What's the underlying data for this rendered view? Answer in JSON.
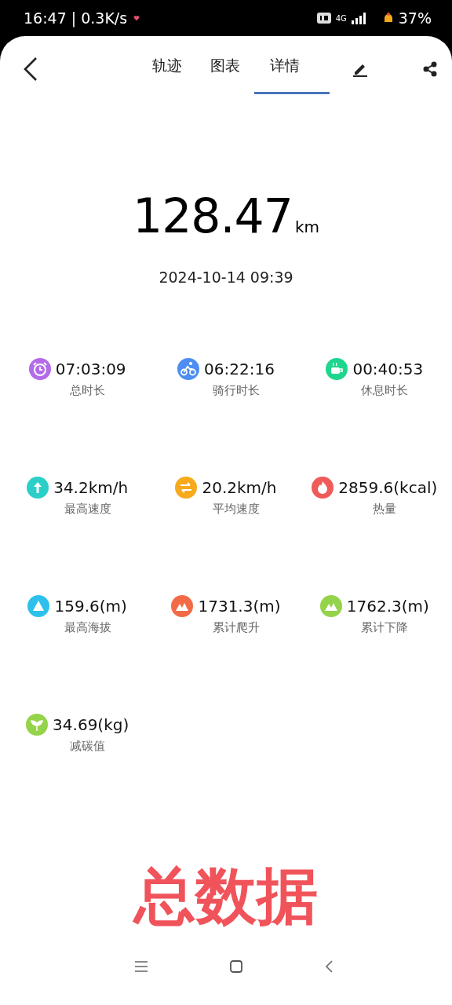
{
  "status_bar": {
    "time": "16:47",
    "separator": "|",
    "speed": "0.3K/s",
    "network": "4G",
    "battery": "37%"
  },
  "tabs": [
    {
      "label": "轨迹",
      "selected": false
    },
    {
      "label": "图表",
      "selected": false
    },
    {
      "label": "详情",
      "selected": true
    }
  ],
  "distance": {
    "value": "128.47",
    "unit": "km"
  },
  "date": "2024-10-14 09:39",
  "stats": [
    {
      "value": "07:03:09",
      "label": "总时长",
      "kind": "clock",
      "color": "#b36be8"
    },
    {
      "value": "06:22:16",
      "label": "骑行时长",
      "kind": "bike",
      "color": "#4f8ef0"
    },
    {
      "value": "00:40:53",
      "label": "休息时长",
      "kind": "cup",
      "color": "#1ed68e"
    },
    {
      "value": "34.2km/h",
      "label": "最高速度",
      "kind": "up",
      "color": "#2bcfc8"
    },
    {
      "value": "20.2km/h",
      "label": "平均速度",
      "kind": "arrows",
      "color": "#f6aa1c"
    },
    {
      "value": "2859.6(kcal)",
      "label": "热量",
      "kind": "flame",
      "color": "#ef5b58"
    },
    {
      "value": "159.6(m)",
      "label": "最高海拔",
      "kind": "peak",
      "color": "#2ec0ec"
    },
    {
      "value": "1731.3(m)",
      "label": "累计爬升",
      "kind": "mountain",
      "color": "#f26b46"
    },
    {
      "value": "1762.3(m)",
      "label": "累计下降",
      "kind": "mountain",
      "color": "#95d34a"
    },
    {
      "value": "34.69(kg)",
      "label": "减碳值",
      "kind": "sprout",
      "color": "#95d34a"
    }
  ],
  "overlay_caption": "总数据"
}
